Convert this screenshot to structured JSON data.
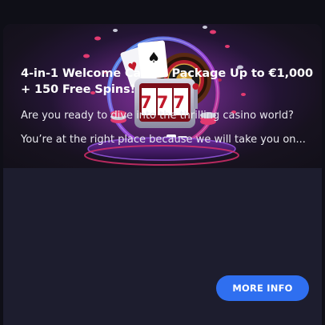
{
  "card": {
    "title": "4-in-1 Welcome Casino Package Up to €1,000 + 150 Free Spins!",
    "paragraph_1": "Are you ready to dive into the thrilling casino world?",
    "paragraph_2": "You’re at the right place because we will take you on...",
    "button_label": "MORE INFO",
    "slot_digits": "777"
  },
  "colors": {
    "page_background": "#0f0f17",
    "card_background": "#1d1d2e",
    "button": "#2f6ff0",
    "neon_blue": "#3aa7ff",
    "neon_pink": "#e0306e",
    "slot_red": "#c0182a"
  },
  "icons": [
    "playing-cards-icon",
    "roulette-wheel-icon",
    "slot-machine-icon",
    "casino-chips-icon",
    "dice-icon"
  ]
}
